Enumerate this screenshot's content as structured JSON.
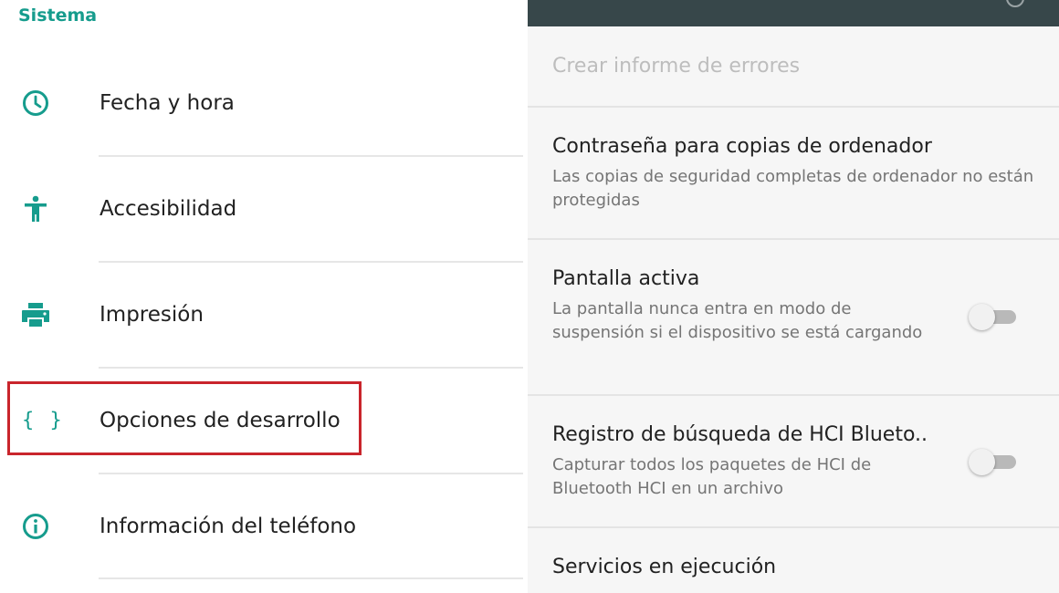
{
  "left_panel": {
    "section_title": "Sistema",
    "items": [
      {
        "label": "Fecha y hora",
        "icon": "clock-icon"
      },
      {
        "label": "Accesibilidad",
        "icon": "accessibility-icon"
      },
      {
        "label": "Impresión",
        "icon": "printer-icon"
      },
      {
        "label": "Opciones de desarrollo",
        "icon": "braces-icon",
        "icon_text": "{ }"
      },
      {
        "label": "Información del teléfono",
        "icon": "info-icon"
      }
    ]
  },
  "right_panel": {
    "prefs": [
      {
        "title": "Crear informe de errores",
        "summary": "",
        "disabled": true
      },
      {
        "title": "Contraseña para copias de ordenador",
        "summary": "Las copias de seguridad completas de ordenador no están protegidas"
      },
      {
        "title": "Pantalla activa",
        "summary": "La pantalla nunca entra en modo de suspensión si el dispositivo se está cargando",
        "switch_on": false
      },
      {
        "title": "Registro de búsqueda de HCI Blueto..",
        "summary": "Capturar todos los paquetes de HCI de Bluetooth HCI en un archivo",
        "switch_on": false
      },
      {
        "title": "Servicios en ejecución",
        "summary": ""
      }
    ]
  },
  "colors": {
    "accent": "#169c8d",
    "highlight": "#c9252c",
    "topbar": "#37474a"
  }
}
